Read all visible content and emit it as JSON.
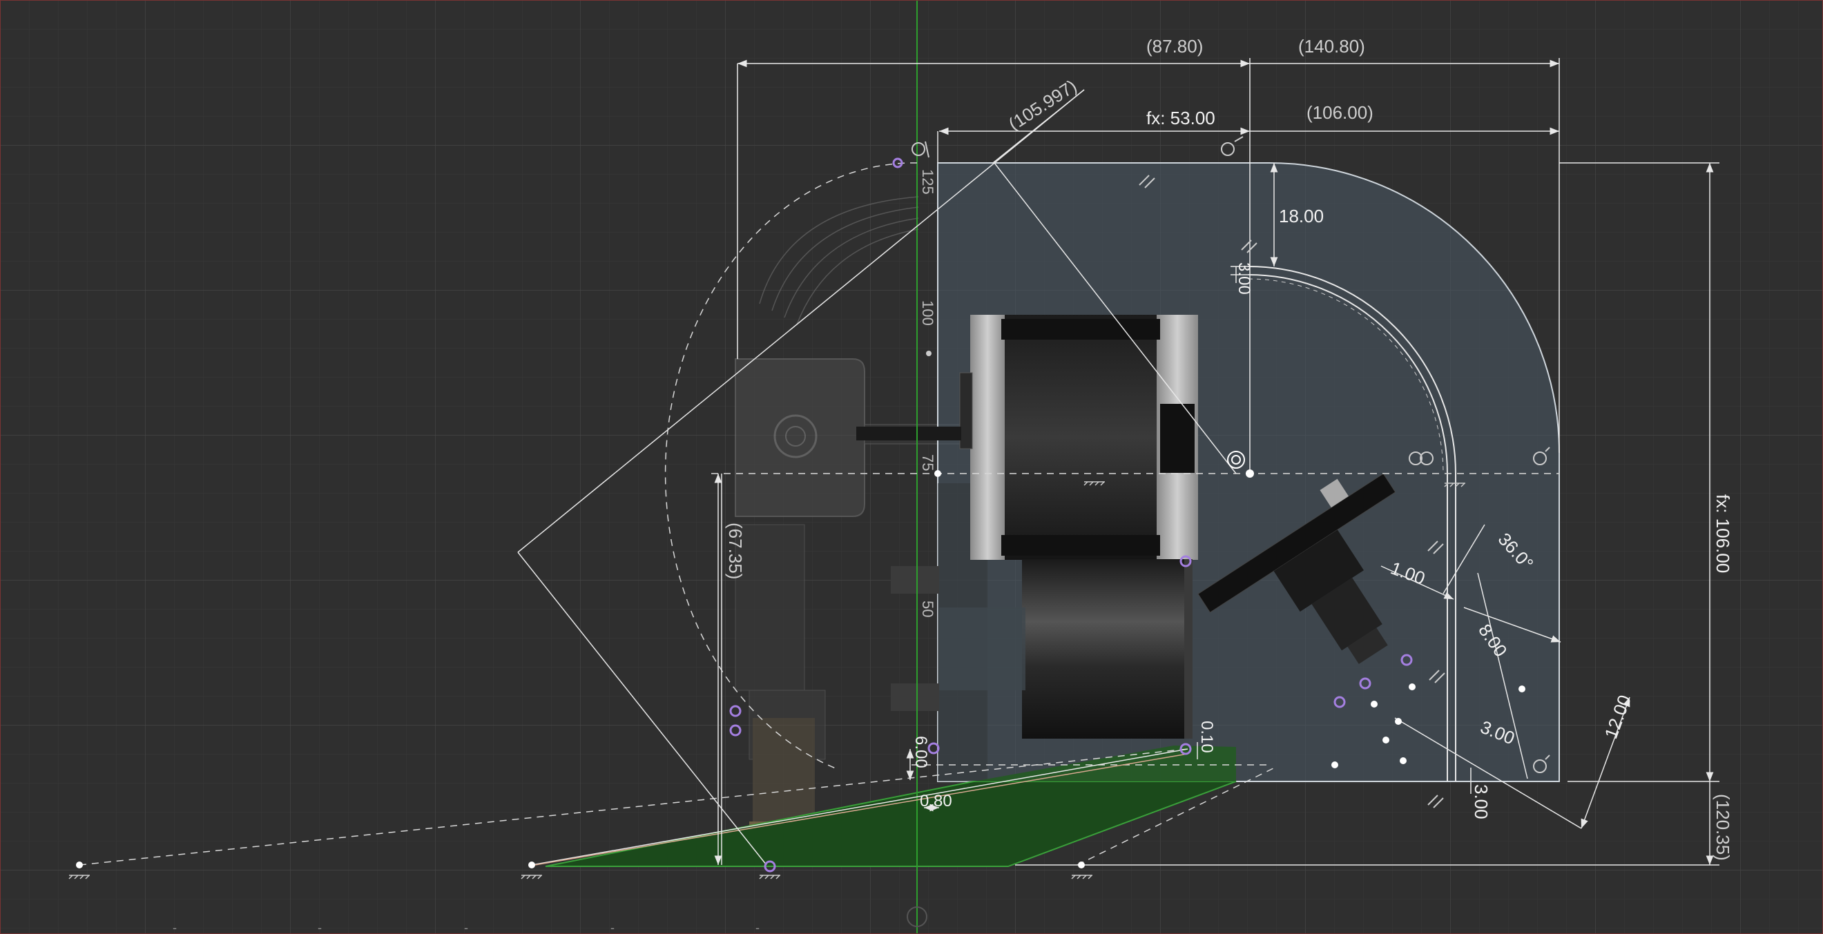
{
  "viewport": {
    "grid_minor": "#383838",
    "grid_major": "#444444",
    "background": "#2f2f2f",
    "axis_color": "#2e9e2e",
    "sketch_line_color": "#e8e8e8",
    "constraint_point_color": "#a47fe0",
    "dimension_color": "#f2f2f2"
  },
  "dimensions": {
    "d_87_80": "(87.80)",
    "d_140_80": "(140.80)",
    "d_105_997": "(105.997)",
    "d_fx53": "fx: 53.00",
    "d_106_00": "(106.00)",
    "d_fx106": "fx: 106.00",
    "d_120_35": "(120.35)",
    "d_67_35": "(67.35)",
    "d_18_00": "18.00",
    "d_3_00_top": "3.00",
    "d_36deg": "36.0°",
    "d_1_00": "1.00",
    "d_8_00": "8.00",
    "d_12_00": "12.00",
    "d_3_00_right": "3.00",
    "d_3_00_bottom": "3.00",
    "d_0_10": "0.10",
    "d_6_00": "6.00",
    "d_0_80": "0.80"
  },
  "ruler": {
    "ticks": [
      "125",
      "100",
      "75",
      "50"
    ]
  },
  "bottom_ruler": {
    "ticks": [
      "-",
      "-",
      "-",
      "-",
      "-"
    ]
  },
  "icons": {
    "ground": "ground-constraint-icon",
    "parallel": "parallel-constraint-icon",
    "tangent": "tangent-constraint-icon",
    "concentric": "concentric-constraint-icon",
    "origin": "origin-point-icon"
  }
}
